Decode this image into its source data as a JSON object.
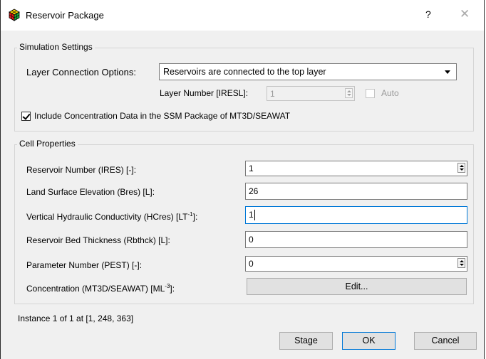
{
  "window": {
    "title": "Reservoir Package",
    "help_label": "?",
    "close_label": "✕"
  },
  "simulation": {
    "group_title": "Simulation Settings",
    "layer_connection_label": "Layer Connection Options:",
    "layer_connection_value": "Reservoirs are connected to the top layer",
    "layer_number_label": "Layer Number [IRESL]:",
    "layer_number_value": "1",
    "auto_label": "Auto",
    "auto_checked": false,
    "include_concentration_label": "Include Concentration Data in the SSM Package of MT3D/SEAWAT",
    "include_concentration_checked": true
  },
  "cell": {
    "group_title": "Cell Properties",
    "reservoir_number_label": "Reservoir Number (IRES) [-]:",
    "reservoir_number_value": "1",
    "land_surface_label": "Land Surface Elevation (Bres) [L]:",
    "land_surface_value": "26",
    "vhc_label_main": "Vertical Hydraulic Conductivity (HCres) [LT",
    "vhc_label_sup": "-1",
    "vhc_label_end": "]:",
    "vhc_value": "1",
    "bed_thickness_label": "Reservoir Bed Thickness (Rbthck) [L]:",
    "bed_thickness_value": "0",
    "parameter_number_label": "Parameter Number (PEST) [-]:",
    "parameter_number_value": "0",
    "concentration_label_main": "Concentration (MT3D/SEAWAT) [ML",
    "concentration_label_sup": "-3",
    "concentration_label_end": "]:",
    "edit_button_label": "Edit..."
  },
  "footer": {
    "instance_text": "Instance 1 of 1 at [1, 248, 363]",
    "stage_label": "Stage",
    "ok_label": "OK",
    "cancel_label": "Cancel"
  },
  "icons": {
    "app": "colored-grid-cube-icon",
    "help": "question-mark-icon",
    "close": "close-icon"
  },
  "colors": {
    "accent": "#0078d7",
    "dialog_bg": "#f0f0f0"
  }
}
